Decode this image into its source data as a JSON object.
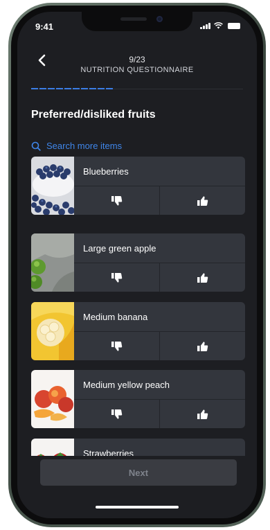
{
  "status_bar": {
    "time": "9:41"
  },
  "header": {
    "step": "9/23",
    "title": "NUTRITION QUESTIONNAIRE",
    "back_icon": "chevron-left-icon"
  },
  "progress": {
    "value": 0.39
  },
  "section": {
    "title": "Preferred/disliked fruits"
  },
  "search": {
    "label": "Search more items",
    "icon": "search-icon"
  },
  "items": [
    {
      "name": "Blueberries",
      "image": "blueberries"
    },
    {
      "name": "Large green apple",
      "image": "green-apple"
    },
    {
      "name": "Medium banana",
      "image": "banana"
    },
    {
      "name": "Medium yellow peach",
      "image": "peach"
    },
    {
      "name": "Strawberries",
      "image": "strawberries"
    }
  ],
  "vote_icons": {
    "dislike": "thumbs-down-icon",
    "like": "thumbs-up-icon"
  },
  "footer": {
    "next_label": "Next"
  },
  "colors": {
    "background": "#1d1e22",
    "card": "#33363d",
    "accent": "#3f86ea",
    "button_disabled": "#3a3c42"
  }
}
